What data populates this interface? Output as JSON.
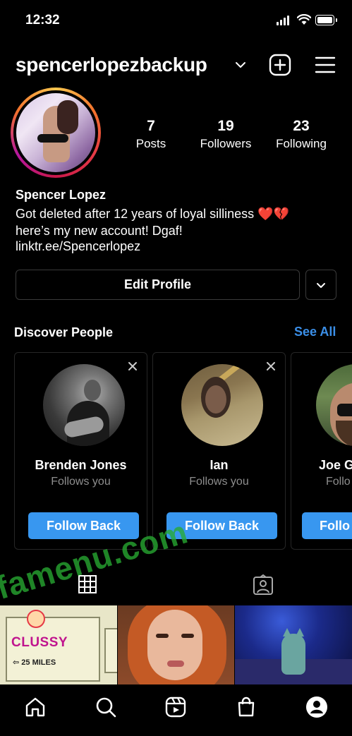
{
  "status_bar": {
    "time": "12:32"
  },
  "header": {
    "username": "spencerlopezbackup"
  },
  "stats": [
    {
      "value": "7",
      "label": "Posts"
    },
    {
      "value": "19",
      "label": "Followers"
    },
    {
      "value": "23",
      "label": "Following"
    }
  ],
  "bio": {
    "name": "Spencer Lopez",
    "line1": "Got deleted after 12 years of loyal silliness ❤️💔",
    "line2": "here’s my new account! Dgaf!",
    "link": "linktr.ee/Spencerlopez"
  },
  "actions": {
    "edit_profile": "Edit Profile"
  },
  "discover": {
    "title": "Discover People",
    "see_all": "See All",
    "cards": [
      {
        "name": "Brenden Jones",
        "subtitle": "Follows you",
        "button": "Follow Back"
      },
      {
        "name": "Ian",
        "subtitle": "Follows you",
        "button": "Follow Back"
      },
      {
        "name": "Joe G",
        "subtitle": "Follo",
        "button": "Follo"
      }
    ]
  },
  "grid_photos": {
    "photo1_text": "CLUSSY",
    "photo1_subtext": "⇦ 25 MILES"
  },
  "watermark": "famenu.com",
  "colors": {
    "accent": "#3897f0",
    "background": "#000000",
    "border": "#262626"
  },
  "icons": [
    "chevron-down-icon",
    "new-post-icon",
    "menu-icon",
    "close-icon",
    "grid-icon",
    "tagged-icon",
    "home-icon",
    "search-icon",
    "reels-icon",
    "shop-icon",
    "profile-icon"
  ]
}
